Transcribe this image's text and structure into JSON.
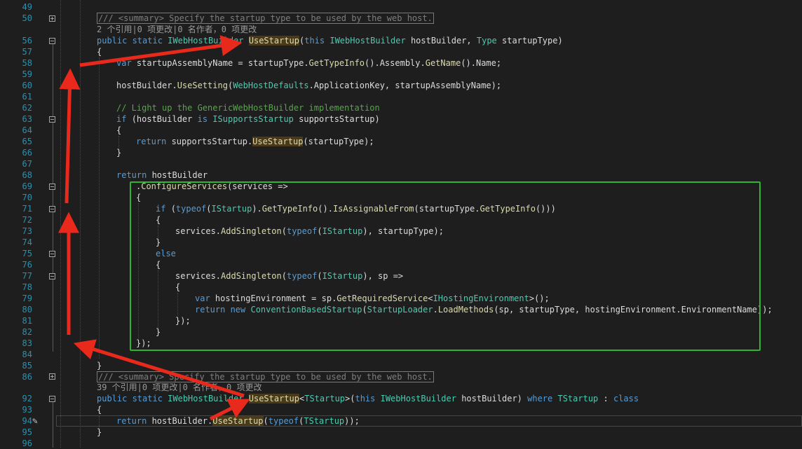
{
  "editor": {
    "line_numbers": [
      "49",
      "50",
      "56",
      "57",
      "58",
      "59",
      "60",
      "61",
      "62",
      "63",
      "64",
      "65",
      "66",
      "67",
      "68",
      "69",
      "70",
      "71",
      "72",
      "73",
      "74",
      "75",
      "76",
      "77",
      "78",
      "79",
      "80",
      "81",
      "82",
      "83",
      "84",
      "85",
      "86",
      "92",
      "93",
      "94",
      "95",
      "96"
    ],
    "codelens_1": "2 个引用|0 项更改|0 名作者，0 项更改",
    "codelens_2": "39 个引用|0 项更改|0 名作者，0 项更改",
    "summary_text": "/// <summary> Specify the startup type to be used by the web host.",
    "lines": {
      "l56_kw1": "public static ",
      "l56_ty1": "IWebHostBuilder ",
      "l56_method": "UseStartup",
      "l56_p1": "(",
      "l56_kw2": "this ",
      "l56_ty2": "IWebHostBuilder ",
      "l56_p2": "hostBuilder, ",
      "l56_ty3": "Type ",
      "l56_p3": "startupType)",
      "l57": "{",
      "l58_kw": "var ",
      "l58_a": "startupAssemblyName = startupType.",
      "l58_m1": "GetTypeInfo",
      "l58_b": "().Assembly.",
      "l58_m2": "GetName",
      "l58_c": "().Name;",
      "l60_a": "hostBuilder.",
      "l60_m": "UseSetting",
      "l60_b": "(",
      "l60_ty": "WebHostDefaults",
      "l60_c": ".ApplicationKey, startupAssemblyName);",
      "l62": "// Light up the GenericWebHostBuilder implementation",
      "l63_kw": "if ",
      "l63_a": "(hostBuilder ",
      "l63_kw2": "is ",
      "l63_ty": "ISupportsStartup ",
      "l63_b": "supportsStartup)",
      "l64": "{",
      "l65_kw": "return ",
      "l65_a": "supportsStartup.",
      "l65_m": "UseStartup",
      "l65_b": "(startupType);",
      "l66": "}",
      "l68_kw": "return ",
      "l68_a": "hostBuilder",
      "l69_a": ".",
      "l69_m": "ConfigureServices",
      "l69_b": "(services =>",
      "l70": "{",
      "l71_kw": "if ",
      "l71_a": "(",
      "l71_kw2": "typeof",
      "l71_b": "(",
      "l71_ty": "IStartup",
      "l71_c": ").",
      "l71_m1": "GetTypeInfo",
      "l71_d": "().",
      "l71_m2": "IsAssignableFrom",
      "l71_e": "(startupType.",
      "l71_m3": "GetTypeInfo",
      "l71_f": "()))",
      "l72": "{",
      "l73_a": "services.",
      "l73_m": "AddSingleton",
      "l73_b": "(",
      "l73_kw": "typeof",
      "l73_c": "(",
      "l73_ty": "IStartup",
      "l73_d": "), startupType);",
      "l74": "}",
      "l75_kw": "else",
      "l76": "{",
      "l77_a": "services.",
      "l77_m": "AddSingleton",
      "l77_b": "(",
      "l77_kw": "typeof",
      "l77_c": "(",
      "l77_ty": "IStartup",
      "l77_d": "), sp =>",
      "l78": "{",
      "l79_kw": "var ",
      "l79_a": "hostingEnvironment = sp.",
      "l79_m": "GetRequiredService",
      "l79_b": "<",
      "l79_ty": "IHostingEnvironment",
      "l79_c": ">();",
      "l80_kw": "return ",
      "l80_kw2": "new ",
      "l80_ty1": "ConventionBasedStartup",
      "l80_a": "(",
      "l80_ty2": "StartupLoader",
      "l80_b": ".",
      "l80_m": "LoadMethods",
      "l80_c": "(sp, startupType, hostingEnvironment.EnvironmentName));",
      "l81": "});",
      "l82": "}",
      "l83": "});",
      "l85": "}",
      "l92_kw1": "public static ",
      "l92_ty1": "IWebHostBuilder ",
      "l92_method": "UseStartup",
      "l92_a": "<",
      "l92_ty2": "TStartup",
      "l92_b": ">(",
      "l92_kw2": "this ",
      "l92_ty3": "IWebHostBuilder ",
      "l92_c": "hostBuilder) ",
      "l92_kw3": "where ",
      "l92_ty4": "TStartup ",
      "l92_d": ": ",
      "l92_kw4": "class",
      "l93": "{",
      "l94_kw": "return ",
      "l94_a": "hostBuilder.",
      "l94_m": "UseStartup",
      "l94_b": "(",
      "l94_kw2": "typeof",
      "l94_c": "(",
      "l94_ty": "TStartup",
      "l94_d": "));",
      "l95": "}"
    }
  },
  "annotations": {
    "arrow_color": "#e8291c",
    "box_color": "#2fb52f"
  }
}
